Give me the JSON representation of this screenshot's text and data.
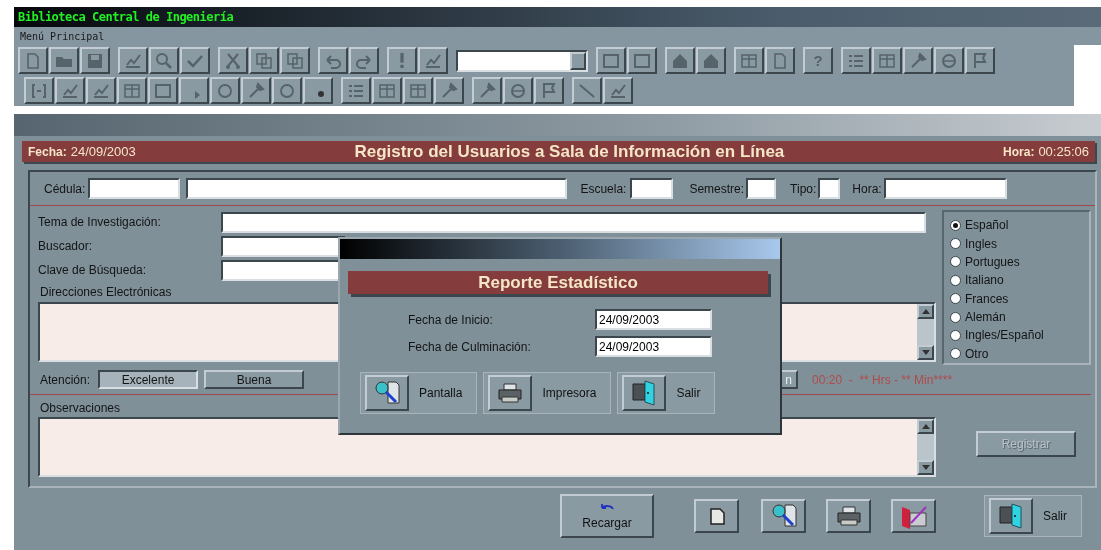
{
  "window": {
    "title": "Biblioteca Central de Ingeniería"
  },
  "menu": [
    {
      "label": "Menú Principal"
    }
  ],
  "toolbar": {
    "help_button": "?"
  },
  "form": {
    "header": {
      "date_label": "Fecha:",
      "date": "24/09/2003",
      "title": "Registro del Usuarios a Sala de Información en Línea",
      "time_label": "Hora:",
      "time": "00:25:06"
    },
    "cedula_label": "Cédula:",
    "escuela_label": "Escuela:",
    "semestre_label": "Semestre:",
    "tipo_label": "Tipo:",
    "hora_label": "Hora:",
    "tema_label": "Tema de Investigación:",
    "buscador_label": "Buscador:",
    "clave_label": "Clave de Búsqueda:",
    "direcciones_label": "Direcciones Electrónicas",
    "languages": [
      {
        "label": "Español",
        "selected": true
      },
      {
        "label": "Ingles",
        "selected": false
      },
      {
        "label": "Portugues",
        "selected": false
      },
      {
        "label": "Italiano",
        "selected": false
      },
      {
        "label": "Frances",
        "selected": false
      },
      {
        "label": "Alemán",
        "selected": false
      },
      {
        "label": "Ingles/Español",
        "selected": false
      },
      {
        "label": "Otro",
        "selected": false
      }
    ],
    "attention": {
      "label": "Atención:",
      "options": [
        {
          "label": "Excelente",
          "selected": true
        },
        {
          "label": "Buena",
          "selected": false
        }
      ],
      "partial_button": "n",
      "timer": "00:20  -  ** Hrs - ** Min****"
    },
    "observaciones_label": "Observaciones",
    "register_button": {
      "label": "Registrar",
      "disabled": true
    }
  },
  "bottom_bar": {
    "reload_button": "Recargar",
    "exit_button": "Salir"
  },
  "dialog": {
    "title": "Reporte Estadístico",
    "fields": [
      {
        "label": "Fecha de Inicio:",
        "value": "24/09/2003"
      },
      {
        "label": "Fecha de Culminación:",
        "value": "24/09/2003"
      }
    ],
    "buttons": [
      {
        "kind": "screen",
        "label": "Pantalla"
      },
      {
        "kind": "printer",
        "label": "Impresora"
      },
      {
        "kind": "exit",
        "label": "Salir"
      }
    ]
  }
}
